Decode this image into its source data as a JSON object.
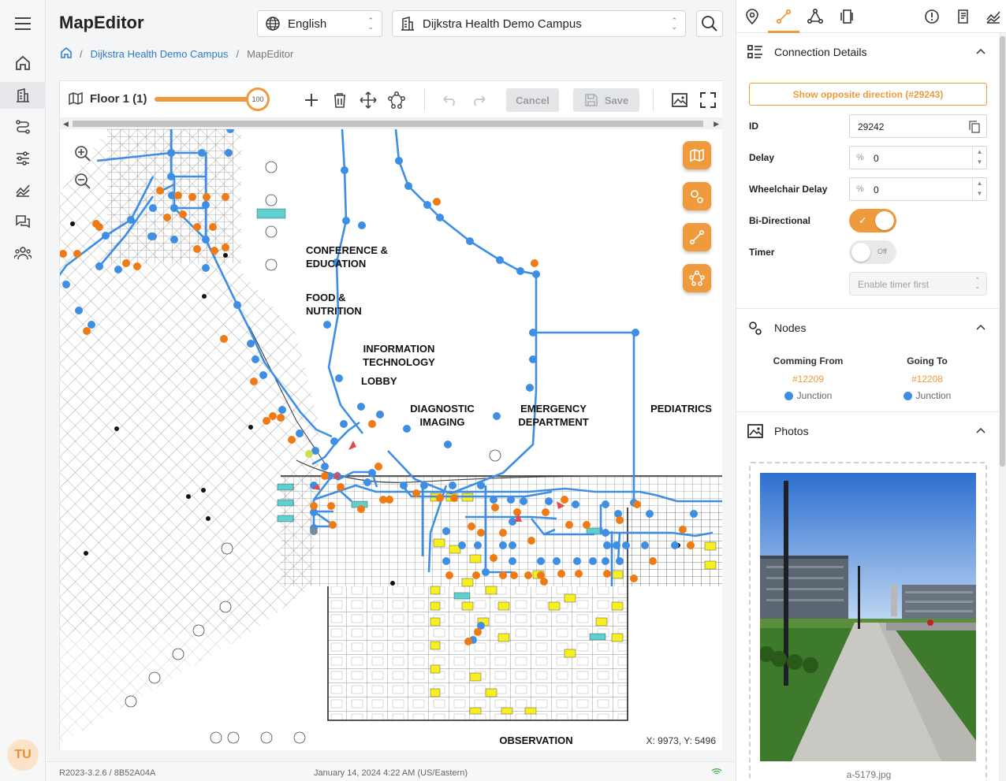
{
  "app": {
    "title": "MapEditor",
    "language": "English",
    "campus": "Dijkstra Health Demo Campus"
  },
  "breadcrumb": {
    "campus": "Dijkstra Health Demo Campus",
    "current": "MapEditor"
  },
  "toolbar": {
    "floor_label": "Floor 1 (1)",
    "slider_value": "100",
    "cancel_label": "Cancel",
    "save_label": "Save"
  },
  "map": {
    "coords": "X: 9973, Y: 5496",
    "labels": {
      "conference": "CONFERENCE & EDUCATION",
      "food": "FOOD & NUTRITION",
      "it": "INFORMATION TECHNOLOGY",
      "lobby": "LOBBY",
      "imaging": "DIAGNOSTIC IMAGING",
      "emergency": "EMERGENCY DEPARTMENT",
      "pediatrics": "PEDIATRICS",
      "observation": "OBSERVATION"
    }
  },
  "status": {
    "version": "R2023-3.2.6 / 8B52A04A",
    "datetime": "January 14, 2024 4:22 AM (US/Eastern)"
  },
  "user": {
    "initials": "TU"
  },
  "panel": {
    "connection": {
      "title": "Connection Details",
      "opposite_label": "Show opposite direction (#29243)",
      "id_label": "ID",
      "id_value": "29242",
      "delay_label": "Delay",
      "delay_value": "0",
      "wheelchair_label": "Wheelchair Delay",
      "wheelchair_value": "0",
      "bidir_label": "Bi-Directional",
      "bidir_on": true,
      "timer_label": "Timer",
      "timer_state": "Off",
      "timer_placeholder": "Enable timer first"
    },
    "nodes": {
      "title": "Nodes",
      "from_label": "Comming From",
      "from_id": "#12209",
      "from_type": "Junction",
      "to_label": "Going To",
      "to_id": "#12208",
      "to_type": "Junction"
    },
    "photos": {
      "title": "Photos",
      "caption": "a-5179.jpg"
    }
  },
  "colors": {
    "accent": "#ef9a3c",
    "node_blue": "#3d8ee4",
    "node_orange": "#f07a14",
    "link": "#2f7ac4"
  }
}
